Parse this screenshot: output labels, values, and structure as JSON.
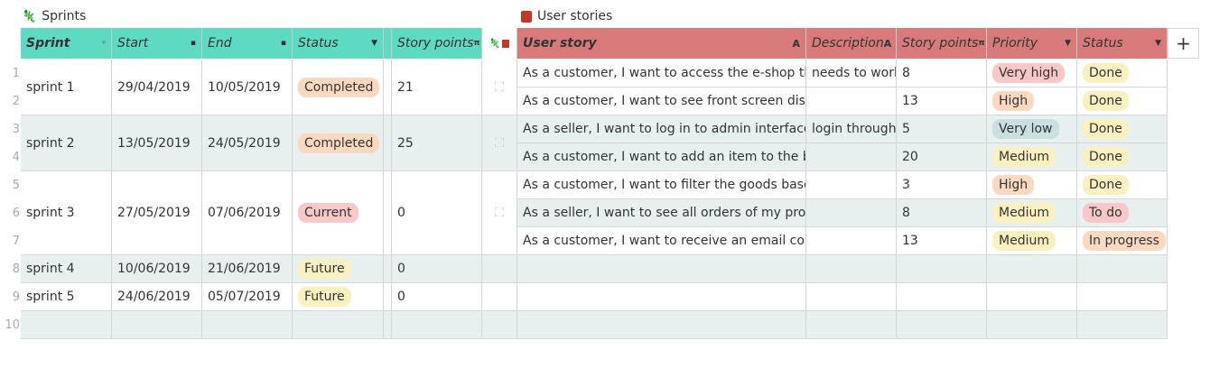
{
  "sprints_widget": {
    "title": "Sprints",
    "columns": [
      "Sprint",
      "Start",
      "End",
      "Status",
      "Story points"
    ],
    "rows": [
      {
        "sprint": "sprint 1",
        "start": "29/04/2019",
        "end": "10/05/2019",
        "status": "Completed",
        "points": "21"
      },
      {
        "sprint": "sprint 2",
        "start": "13/05/2019",
        "end": "24/05/2019",
        "status": "Completed",
        "points": "25"
      },
      {
        "sprint": "sprint 3",
        "start": "27/05/2019",
        "end": "07/06/2019",
        "status": "Current",
        "points": "0"
      },
      {
        "sprint": "sprint 4",
        "start": "10/06/2019",
        "end": "21/06/2019",
        "status": "Future",
        "points": "0"
      },
      {
        "sprint": "sprint 5",
        "start": "24/06/2019",
        "end": "05/07/2019",
        "status": "Future",
        "points": "0"
      }
    ]
  },
  "stories_widget": {
    "title": "User stories",
    "columns": [
      "User story",
      "Description",
      "Story points",
      "Priority",
      "Status"
    ],
    "rows": [
      {
        "story": "As a customer, I want to access the e-shop thro",
        "description": "needs to work",
        "points": "8",
        "priority": "Very high",
        "status": "Done"
      },
      {
        "story": "As a customer, I want to see front screen displa",
        "description": "",
        "points": "13",
        "priority": "High",
        "status": "Done"
      },
      {
        "story": "As a seller, I want to log in to admin interface, se",
        "description": "login through",
        "points": "5",
        "priority": "Very low",
        "status": "Done"
      },
      {
        "story": "As a customer, I want to add an item to the basl",
        "description": "",
        "points": "20",
        "priority": "Medium",
        "status": "Done"
      },
      {
        "story": "As a customer, I want to filter the goods based c",
        "description": "",
        "points": "3",
        "priority": "High",
        "status": "Done"
      },
      {
        "story": "As a seller, I want to see all orders of my produc",
        "description": "",
        "points": "8",
        "priority": "Medium",
        "status": "To do"
      },
      {
        "story": "As a customer, I want to receive an email confir",
        "description": "",
        "points": "13",
        "priority": "Medium",
        "status": "In progress"
      }
    ]
  },
  "row_numbers": [
    "1",
    "2",
    "3",
    "4",
    "5",
    "6",
    "7",
    "8",
    "9",
    "10"
  ],
  "add_column_label": "+",
  "colors": {
    "sprints_header": "#5fdac2",
    "stories_header": "#d97a7a",
    "chip_completed": "#fbd9c0",
    "chip_current": "#f8c8c8",
    "chip_future": "#fbf0bf",
    "chip_very_high": "#f8c8c8",
    "chip_high": "#fbd9c0",
    "chip_very_low": "#c9dfe2",
    "chip_medium": "#fbf0bf",
    "chip_done": "#fbf0bf",
    "chip_todo": "#f8c8c8",
    "chip_in_progress": "#fbd9c0"
  }
}
